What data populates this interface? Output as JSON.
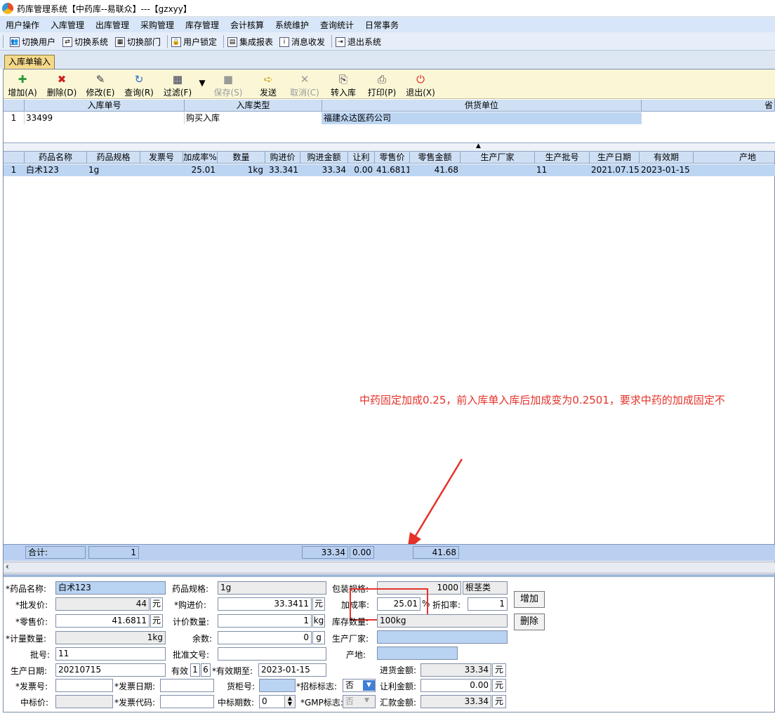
{
  "app": {
    "title": "药库管理系统【中药库--易联众】---【gzxyy】"
  },
  "menu": [
    "用户操作",
    "入库管理",
    "出库管理",
    "采购管理",
    "库存管理",
    "会计核算",
    "系统维护",
    "查询统计",
    "日常事务"
  ],
  "toolbar1": [
    "切换用户",
    "切换系统",
    "切换部门",
    "用户锁定",
    "集成报表",
    "消息收发",
    "退出系统"
  ],
  "tab": "入库单输入",
  "toolbar2": [
    "增加(A)",
    "删除(D)",
    "修改(E)",
    "查询(R)",
    "过滤(F)",
    "保存(S)",
    "发送",
    "取消(C)",
    "转入库",
    "打印(P)",
    "退出(X)"
  ],
  "header_table": {
    "columns": [
      "入库单号",
      "入库类型",
      "供货单位",
      "省"
    ],
    "row": {
      "no": "1",
      "id": "33499",
      "type": "购买入库",
      "supplier": "福建众达医药公司"
    }
  },
  "detail_table": {
    "columns": [
      "药品名称",
      "药品规格",
      "发票号",
      "加成率%",
      "数量",
      "购进价",
      "购进金额",
      "让利",
      "零售价",
      "零售金额",
      "生产厂家",
      "生产批号",
      "生产日期",
      "有效期",
      "产地"
    ],
    "rows": [
      {
        "no": "1",
        "name": "白术123",
        "spec": "1g",
        "invoice": "",
        "markup": "25.01",
        "qty": "1kg",
        "price": "33.341",
        "amount": "33.34",
        "discount": "0.00",
        "retail": "41.6811",
        "retail_amount": "41.68",
        "maker": "",
        "batch": "11",
        "prod_date": "2021.07.15",
        "expiry": "2023-01-15",
        "origin": ""
      }
    ]
  },
  "totals": {
    "label": "合计:",
    "qty": "1",
    "amount": "33.34",
    "discount": "0.00",
    "retail_amount": "41.68"
  },
  "annotation": "中药固定加成0.25，前入库单入库后加成变为0.2501，要求中药的加成固定不",
  "form": {
    "drug_name_label": "*药品名称:",
    "drug_name": "白术123",
    "spec_label": "药品规格:",
    "spec": "1g",
    "pack_label": "包装规格:",
    "pack": "1000",
    "pack_unit": "根茎类",
    "wholesale_label": "*批发价:",
    "wholesale": "44",
    "yuan": "元",
    "purchase_price_label": "*购进价:",
    "purchase_price": "33.3411",
    "markup_label": "加成率:",
    "markup": "25.01",
    "percent": "%",
    "discount_rate_label": "折扣率:",
    "discount_rate": "1",
    "retail_label": "*零售价:",
    "retail": "41.6811",
    "pricing_qty_label": "计价数量:",
    "pricing_qty": "1",
    "pricing_unit": "kg",
    "stock_qty_label": "库存数量:",
    "stock_qty": "100kg",
    "measure_qty_label": "*计量数量:",
    "measure_qty": "1kg",
    "remainder_label": "余数:",
    "remainder": "0",
    "remainder_unit": "g",
    "maker_label": "生产厂家:",
    "maker": "",
    "batch_label": "批号:",
    "batch": "11",
    "approval_label": "批准文号:",
    "approval": "",
    "origin_label": "产地:",
    "origin": "",
    "prod_date_label": "生产日期:",
    "prod_date": "20210715",
    "valid_label": "有效",
    "valid_a": "1",
    "valid_b": "6",
    "expiry_label": "*有效期至:",
    "expiry": "2023-01-15",
    "in_amount_label": "进货金额:",
    "in_amount": "33.34",
    "invoice_no_label": "*发票号:",
    "invoice_no": "",
    "invoice_date_label": "*发票日期:",
    "invoice_date": "",
    "shelf_label": "货柜号:",
    "shelf": "",
    "bid_flag_label": "*招标标志:",
    "bid_flag": "否",
    "rebate_amount_label": "让利金额:",
    "rebate_amount": "0.00",
    "bid_price_label": "中标价:",
    "bid_price": "",
    "invoice_code_label": "*发票代码:",
    "invoice_code": "",
    "bid_periods_label": "中标期数:",
    "bid_periods": "0",
    "gmp_label": "*GMP标志:",
    "gmp": "否",
    "remit_label": "汇款金额:",
    "remit": "33.34",
    "add_button": "增加",
    "delete_button": "删除"
  }
}
